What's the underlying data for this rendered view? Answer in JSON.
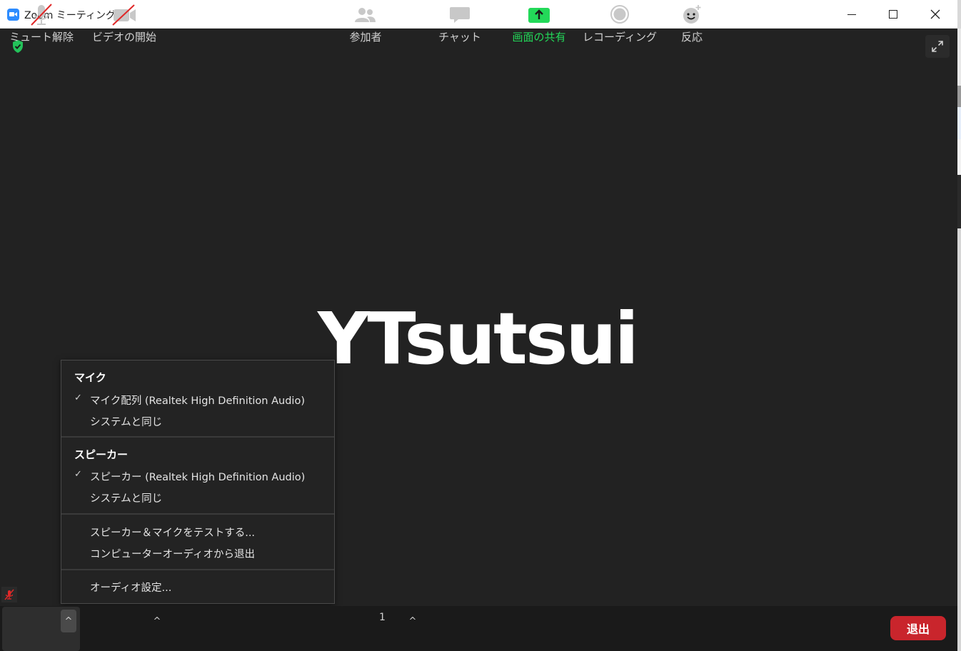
{
  "window": {
    "title": "Zoom ミーティング"
  },
  "video": {
    "participant_name": "YTsutsui"
  },
  "audio_menu": {
    "mic_header": "マイク",
    "mic_items": [
      {
        "label": "マイク配列 (Realtek High Definition Audio)",
        "checked": true
      },
      {
        "label": "システムと同じ",
        "checked": false
      }
    ],
    "speaker_header": "スピーカー",
    "speaker_items": [
      {
        "label": "スピーカー (Realtek High Definition Audio)",
        "checked": true
      },
      {
        "label": "システムと同じ",
        "checked": false
      }
    ],
    "actions": [
      {
        "label": "スピーカー＆マイクをテストする..."
      },
      {
        "label": "コンピューターオーディオから退出"
      }
    ],
    "settings": {
      "label": "オーディオ設定..."
    },
    "check_glyph": "✓"
  },
  "toolbar": {
    "unmute_label": "ミュート解除",
    "start_video_label": "ビデオの開始",
    "participants_label": "参加者",
    "participant_count": "1",
    "chat_label": "チャット",
    "share_screen_label": "画面の共有",
    "recording_label": "レコーディング",
    "reactions_label": "反応",
    "leave_label": "退出",
    "caret_glyph": "^"
  },
  "colors": {
    "background": "#222222",
    "toolbar": "#1a1a1a",
    "share_green": "#23d959",
    "leave_red": "#c9252c",
    "zoom_blue": "#2d8cff",
    "muted_red": "#e02828"
  }
}
